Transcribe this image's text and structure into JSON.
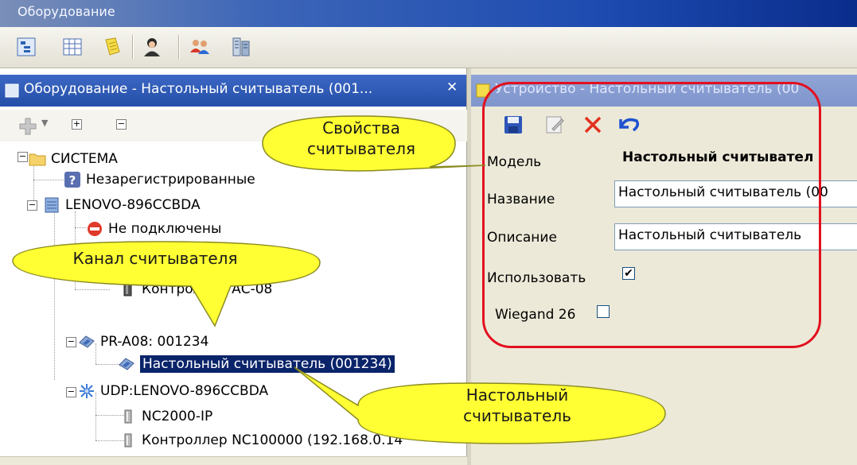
{
  "window": {
    "title": "Оборудование"
  },
  "toolbar": {
    "buttons": [
      "tree-view-icon",
      "grid-view-icon",
      "notes-icon",
      "user-icon",
      "users-icon",
      "devices-icon"
    ]
  },
  "left_panel": {
    "title": "Оборудование - Настольный считыватель (001...",
    "close": "✕",
    "mini_toolbar": {
      "expand": "+",
      "collapse": "−"
    },
    "tree": {
      "system": "СИСТЕМА",
      "unregistered": "Незарегистрированные",
      "host": "LENOVO-896CCBDA",
      "not_connected": "Не подключены",
      "controller_ac08": "Контроллер АС-08",
      "pr_a08": "PR-A08: 001234",
      "desktop_reader": "Настольный считыватель (001234)",
      "udp": "UDP:LENOVO-896CCBDA",
      "nc2000": "NC2000-IP",
      "nc100000": "Контроллер NC100000 (192.168.0.14"
    }
  },
  "right_panel": {
    "title": "Устройство - Настольный считыватель (00",
    "labels": {
      "model": "Модель",
      "name": "Название",
      "description": "Описание",
      "use": "Использовать",
      "wiegand": "Wiegand 26"
    },
    "values": {
      "model": "Настольный считывател",
      "name": "Настольный считыватель (00",
      "description": "Настольный считыватель",
      "use_checked": "✔",
      "wiegand_checked": ""
    }
  },
  "callouts": {
    "reader_properties": "Свойства считывателя",
    "reader_channel": "Канал считывателя",
    "desktop_reader": "Настольный считыватель"
  },
  "colors": {
    "callout_fill": "#ffff33",
    "highlight": "#e2101f",
    "selection": "#0a246a"
  }
}
